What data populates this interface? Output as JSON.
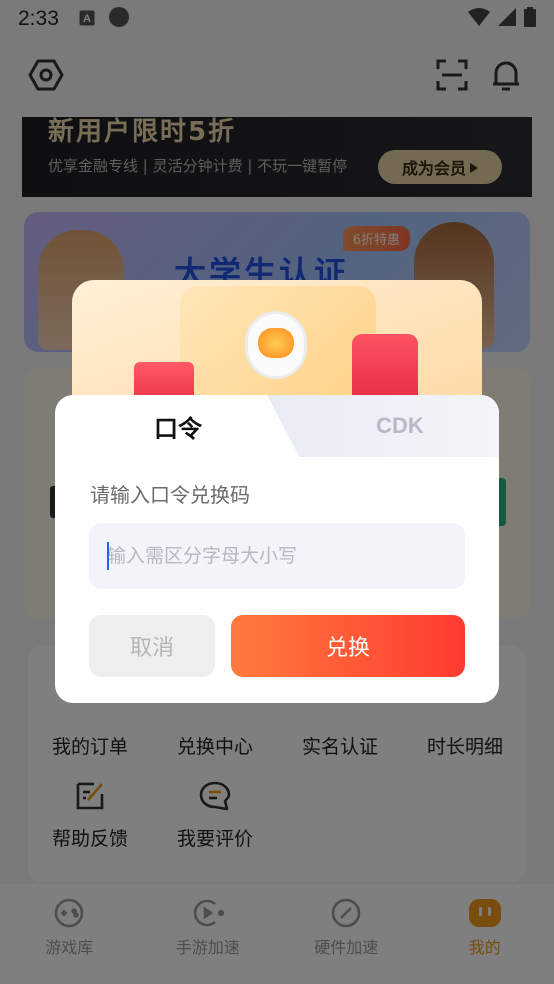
{
  "status_bar": {
    "time": "2:33",
    "icons": [
      "a-letter-icon",
      "circle-icon",
      "wifi-icon",
      "signal-icon",
      "battery-icon"
    ]
  },
  "top_bar": {
    "icons": [
      "settings-hex-icon",
      "scan-icon",
      "bell-icon"
    ]
  },
  "banner": {
    "headline": "新用户限时5折",
    "subtitle": "优享金融专线 | 灵活分钟计费 | 不玩一键暂停",
    "cta": "成为会员"
  },
  "student_card": {
    "title": "大学生认证",
    "tag": "6折特惠"
  },
  "services": [
    {
      "label": "我的订单",
      "icon": "order-icon"
    },
    {
      "label": "兑换中心",
      "icon": "exchange-icon"
    },
    {
      "label": "实名认证",
      "icon": "id-icon"
    },
    {
      "label": "时长明细",
      "icon": "clock-icon"
    },
    {
      "label": "帮助反馈",
      "icon": "feedback-icon"
    },
    {
      "label": "我要评价",
      "icon": "comment-icon"
    }
  ],
  "bottom_nav": [
    {
      "label": "游戏库",
      "icon": "gamepad-icon",
      "active": false
    },
    {
      "label": "手游加速",
      "icon": "mobile-boost-icon",
      "active": false
    },
    {
      "label": "硬件加速",
      "icon": "gauge-icon",
      "active": false
    },
    {
      "label": "我的",
      "icon": "me-icon",
      "active": true
    }
  ],
  "dialog": {
    "tab_active": "口令",
    "tab_inactive": "CDK",
    "prompt": "请输入口令兑换码",
    "input_placeholder": "输入需区分字母大小写",
    "input_value": "",
    "cancel_label": "取消",
    "confirm_label": "兑换"
  },
  "colors": {
    "accent": "#ff5a35",
    "active_nav": "#f39a1c",
    "caret": "#2a5cff"
  }
}
